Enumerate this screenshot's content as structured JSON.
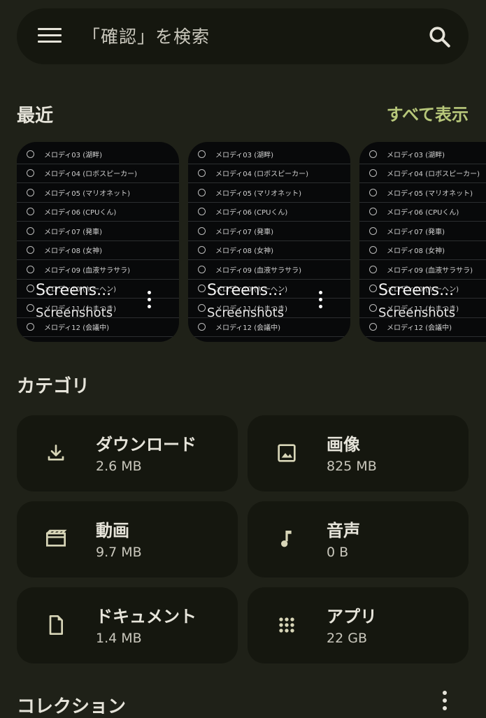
{
  "search": {
    "placeholder": "「確認」を検索"
  },
  "recent": {
    "title": "最近",
    "see_all": "すべて表示",
    "thumb_rows": [
      "メロディ03 (湖畔)",
      "メロディ04 (ロボスピーカー)",
      "メロディ05 (マリオネット)",
      "メロディ06 (CPUくん)",
      "メロディ07 (発車)",
      "メロディ08 (女神)",
      "メロディ09 (血液サラサラ)",
      "メロディ10 (ヤーヘン)",
      "メロディ11 (わまつき)",
      "メロディ12 (会議中)"
    ],
    "cards": [
      {
        "title": "Screens...",
        "subtitle": "Screenshots"
      },
      {
        "title": "Screens...",
        "subtitle": "Screenshots"
      },
      {
        "title": "Screens...",
        "subtitle": "Screenshots"
      }
    ]
  },
  "categories": {
    "title": "カテゴリ",
    "items": [
      {
        "label": "ダウンロード",
        "size": "2.6 MB",
        "icon": "download-icon"
      },
      {
        "label": "画像",
        "size": "825 MB",
        "icon": "image-icon"
      },
      {
        "label": "動画",
        "size": "9.7 MB",
        "icon": "movie-icon"
      },
      {
        "label": "音声",
        "size": "0 B",
        "icon": "music-note-icon"
      },
      {
        "label": "ドキュメント",
        "size": "1.4 MB",
        "icon": "document-icon"
      },
      {
        "label": "アプリ",
        "size": "22 GB",
        "icon": "apps-grid-icon"
      }
    ]
  },
  "collections": {
    "title": "コレクション"
  },
  "colors": {
    "background": "#1f2118",
    "surface": "#15170f",
    "accent": "#b7c77a"
  }
}
